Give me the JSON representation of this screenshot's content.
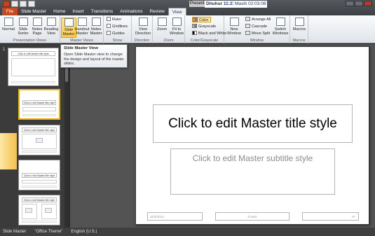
{
  "title_bar": {
    "doc_title": "Presentati",
    "timer_primary": "Dhuhur 11:27:08",
    "timer_secondary": "Masih 02:03:08"
  },
  "tabs": [
    "File",
    "Slide Master",
    "Home",
    "Insert",
    "Transitions",
    "Animations",
    "Review",
    "View"
  ],
  "active_tab": "View",
  "ribbon": {
    "presentation_views": {
      "label": "Presentation Views",
      "buttons": [
        "Normal",
        "Slide Sorter",
        "Notes Page",
        "Reading View"
      ]
    },
    "master_views": {
      "label": "Master Views",
      "buttons": [
        "Slide Master",
        "Handout Master",
        "Notes Master"
      ]
    },
    "show": {
      "label": "Show",
      "items": [
        "Ruler",
        "Gridlines",
        "Guides"
      ]
    },
    "direction": {
      "label": "Direction",
      "button": "View Direction"
    },
    "zoom": {
      "label": "Zoom",
      "buttons": [
        "Zoom",
        "Fit to Window"
      ]
    },
    "color_grayscale": {
      "label": "Color/Grayscale",
      "items": [
        "Color",
        "Grayscale",
        "Black and White"
      ]
    },
    "window": {
      "label": "Window",
      "new_window": "New Window",
      "items": [
        "Arrange All",
        "Cascade",
        "Move Split"
      ],
      "switch": "Switch Windows"
    },
    "macros": {
      "label": "Macros",
      "button": "Macros"
    }
  },
  "tooltip": {
    "title": "Slide Master View",
    "description": "Open Slide Master view to change the design and layout of the master slides."
  },
  "thumbnails": {
    "first_number": "1",
    "thumb_title": "Click to edit Master title style"
  },
  "slide": {
    "title": "Click to edit Master title style",
    "subtitle": "Click to edit Master subtitle style",
    "date": "11/3/2013",
    "footer": "Footer",
    "number": "‹#›"
  },
  "status_bar": {
    "view": "Slide Master",
    "theme": "\"Office Theme\"",
    "language": "English (U.S.)"
  },
  "colors": {
    "file_tab": "#c74a1e",
    "highlight": "#ffc94a",
    "canvas": "#535353"
  }
}
